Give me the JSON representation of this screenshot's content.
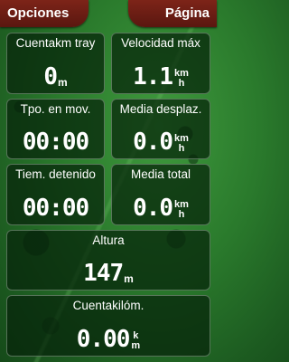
{
  "header": {
    "left_button": "Opciones",
    "right_button": "Página"
  },
  "fields": [
    {
      "label": "Cuentakm tray",
      "value": "0",
      "unit": "m"
    },
    {
      "label": "Velocidad máx",
      "value": "1.1",
      "unit_top": "km",
      "unit_bottom": "h"
    },
    {
      "label": "Tpo. en mov.",
      "value": "00:00"
    },
    {
      "label": "Media desplaz.",
      "value": "0.0",
      "unit_top": "km",
      "unit_bottom": "h"
    },
    {
      "label": "Tiem. detenido",
      "value": "00:00"
    },
    {
      "label": "Media total",
      "value": "0.0",
      "unit_top": "km",
      "unit_bottom": "h"
    },
    {
      "label": "Altura",
      "value": "147",
      "unit": "m"
    },
    {
      "label": "Cuentakilóm.",
      "value": "0.00",
      "unit_top": "k",
      "unit_bottom": "m"
    }
  ],
  "colors": {
    "button_bg": "#6a1d14",
    "field_bg": "#06220a",
    "background": "#2a7a2c"
  }
}
